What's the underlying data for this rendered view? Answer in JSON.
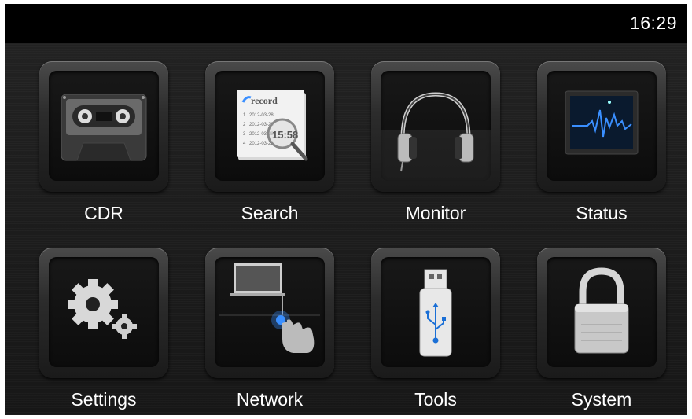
{
  "status_bar": {
    "time": "16:29"
  },
  "tiles": [
    {
      "label": "CDR",
      "icon": "cassette-tape-icon"
    },
    {
      "label": "Search",
      "icon": "record-search-icon",
      "icon_text": {
        "title": "record",
        "rows": [
          "2012-03-28",
          "2012-03-28",
          "2012-03-28",
          "2012-03-28"
        ],
        "row_numbers": [
          "1",
          "2",
          "3",
          "4"
        ],
        "time": "15:58"
      }
    },
    {
      "label": "Monitor",
      "icon": "headphones-icon"
    },
    {
      "label": "Status",
      "icon": "waveform-monitor-icon"
    },
    {
      "label": "Settings",
      "icon": "gears-icon"
    },
    {
      "label": "Network",
      "icon": "network-touch-icon"
    },
    {
      "label": "Tools",
      "icon": "usb-drive-icon"
    },
    {
      "label": "System",
      "icon": "padlock-icon"
    }
  ],
  "colors": {
    "accent_blue": "#3a8fff",
    "background": "#1b1b1b",
    "statusbar": "#000000"
  }
}
